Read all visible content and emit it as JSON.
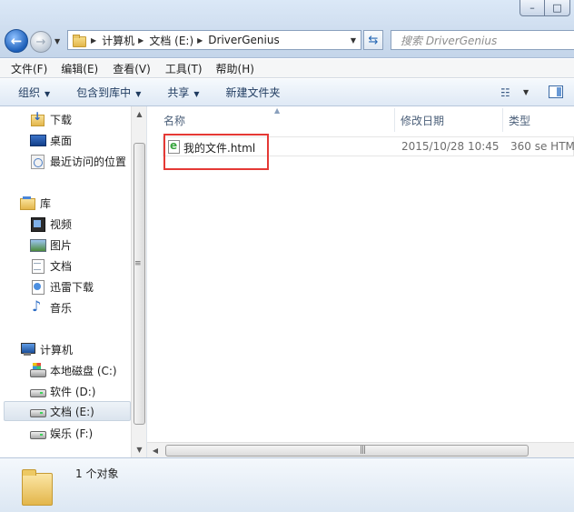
{
  "window": {
    "minimize": "–",
    "maximize": "□"
  },
  "address": {
    "crumbs": [
      "计算机",
      "文档 (E:)",
      "DriverGenius"
    ],
    "search_placeholder": "搜索 DriverGenius"
  },
  "menu": [
    "文件(F)",
    "编辑(E)",
    "查看(V)",
    "工具(T)",
    "帮助(H)"
  ],
  "commands": [
    "组织",
    "包含到库中",
    "共享",
    "新建文件夹"
  ],
  "nav": {
    "favorites": [
      {
        "label": "下载",
        "icon": "download-folder-icon"
      },
      {
        "label": "桌面",
        "icon": "desktop-icon"
      },
      {
        "label": "最近访问的位置",
        "icon": "recent-places-icon"
      }
    ],
    "libraries_label": "库",
    "libraries": [
      {
        "label": "视频",
        "icon": "video-library-icon"
      },
      {
        "label": "图片",
        "icon": "pictures-library-icon"
      },
      {
        "label": "文档",
        "icon": "documents-library-icon"
      },
      {
        "label": "迅雷下载",
        "icon": "thunder-download-icon"
      },
      {
        "label": "音乐",
        "icon": "music-library-icon"
      }
    ],
    "computer_label": "计算机",
    "drives": [
      {
        "label": "本地磁盘 (C:)",
        "icon": "system-drive-icon"
      },
      {
        "label": "软件 (D:)",
        "icon": "drive-icon"
      },
      {
        "label": "文档 (E:)",
        "icon": "drive-icon",
        "selected": true
      },
      {
        "label": "娱乐 (F:)",
        "icon": "drive-icon"
      }
    ]
  },
  "columns": {
    "name": "名称",
    "date": "修改日期",
    "type": "类型"
  },
  "files": [
    {
      "name": "我的文件.html",
      "date": "2015/10/28 10:45",
      "type": "360 se HTM"
    }
  ],
  "status": {
    "count": "1 个对象"
  },
  "colors": {
    "highlight_box": "#e53935",
    "accent": "#1d5fb9"
  }
}
